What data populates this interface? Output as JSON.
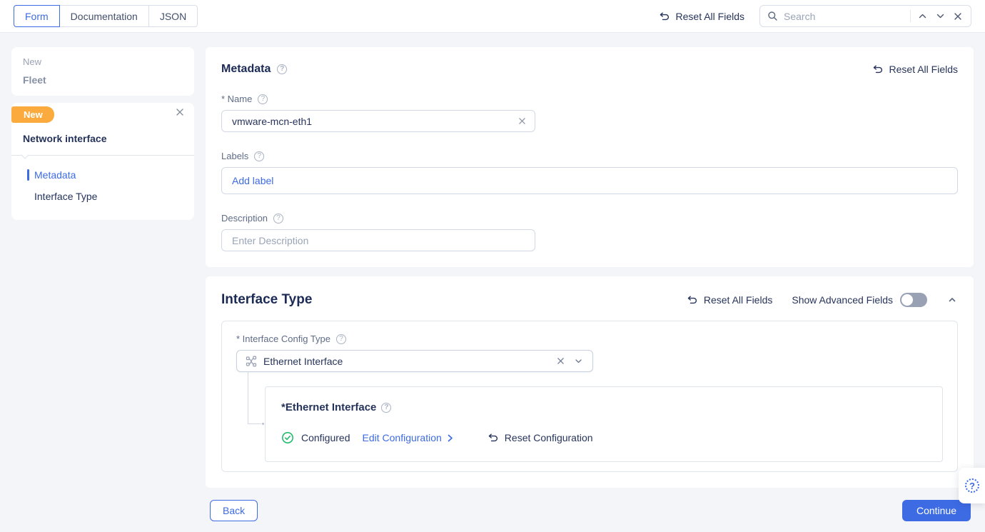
{
  "topbar": {
    "tabs": [
      {
        "label": "Form"
      },
      {
        "label": "Documentation"
      },
      {
        "label": "JSON"
      }
    ],
    "reset_all_label": "Reset All Fields",
    "search": {
      "placeholder": "Search"
    }
  },
  "sidebar": {
    "parent": {
      "kind": "New",
      "name": "Fleet"
    },
    "current": {
      "badge": "New",
      "title": "Network interface",
      "items": [
        {
          "label": "Metadata",
          "active": true
        },
        {
          "label": "Interface Type",
          "active": false
        }
      ]
    }
  },
  "metadata_card": {
    "title": "Metadata",
    "reset_label": "Reset All Fields",
    "name_field": {
      "label": "* Name",
      "value": "vmware-mcn-eth1"
    },
    "labels_field": {
      "label": "Labels",
      "add_label": "Add label"
    },
    "description_field": {
      "label": "Description",
      "placeholder": "Enter Description"
    }
  },
  "interface_card": {
    "title": "Interface Type",
    "reset_label": "Reset All Fields",
    "advanced_label": "Show Advanced Fields",
    "advanced_toggle_on": false,
    "config_type": {
      "label": "* Interface Config Type",
      "value": "Ethernet Interface"
    },
    "ethernet": {
      "title": "*Ethernet Interface",
      "status": "Configured",
      "edit_label": "Edit Configuration",
      "reset_label": "Reset Configuration"
    }
  },
  "footer": {
    "back": "Back",
    "continue": "Continue"
  },
  "colors": {
    "accent_blue": "#3d6be4",
    "badge_orange": "#fbab3d",
    "status_green": "#17b864",
    "navy_text": "#1c2b56",
    "page_bg": "#f4f5f8"
  }
}
